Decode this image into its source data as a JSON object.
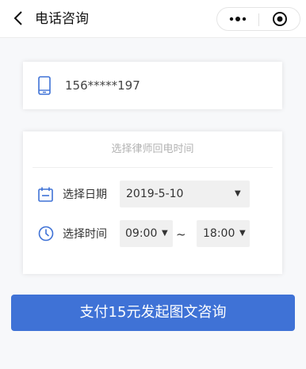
{
  "navbar": {
    "title": "电话咨询",
    "back_icon": "chevron-left-icon",
    "more_icon": "more-dots-icon",
    "close_icon": "target-circle-icon"
  },
  "phone": {
    "icon": "phone-icon",
    "number": "156*****197"
  },
  "callback": {
    "title": "选择律师回电时间",
    "date_icon": "calendar-icon",
    "date_label": "选择日期",
    "date_value": "2019-5-10",
    "time_icon": "clock-icon",
    "time_label": "选择时间",
    "time_start": "09:00",
    "time_separator": "~",
    "time_end": "18:00",
    "arrow": "▼"
  },
  "pay_button": {
    "label": "支付15元发起图文咨询"
  },
  "colors": {
    "accent": "#3f72d6",
    "icon_blue": "#3f72d6"
  }
}
